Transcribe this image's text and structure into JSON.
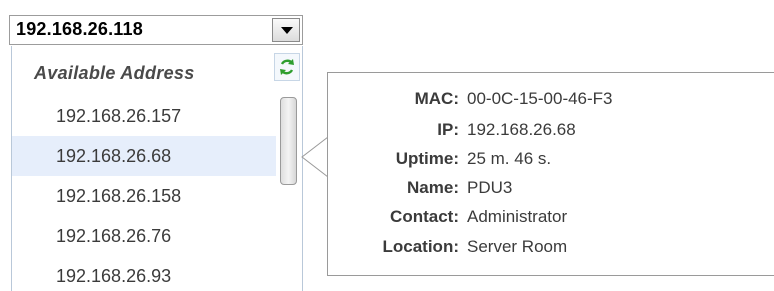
{
  "combo": {
    "selected_value": "192.168.26.118",
    "arrow_icon": "chevron-down-icon"
  },
  "dropdown": {
    "header": "Available Address",
    "refresh_icon": "refresh-icon",
    "refresh_color": "#2e9e2e",
    "items": [
      {
        "label": "192.168.26.157",
        "selected": false
      },
      {
        "label": "192.168.26.68",
        "selected": true
      },
      {
        "label": "192.168.26.158",
        "selected": false
      },
      {
        "label": "192.168.26.76",
        "selected": false
      },
      {
        "label": "192.168.26.93",
        "selected": false
      }
    ],
    "selected_bg": "#e6eefb"
  },
  "tooltip": {
    "rows": [
      {
        "label": "MAC:",
        "value": "00-0C-15-00-46-F3"
      },
      {
        "label": "IP:",
        "value": "192.168.26.68"
      },
      {
        "label": "Uptime:",
        "value": "25 m. 46 s."
      },
      {
        "label": "Name:",
        "value": "PDU3"
      },
      {
        "label": "Contact:",
        "value": "Administrator"
      },
      {
        "label": "Location:",
        "value": "Server Room"
      }
    ]
  }
}
